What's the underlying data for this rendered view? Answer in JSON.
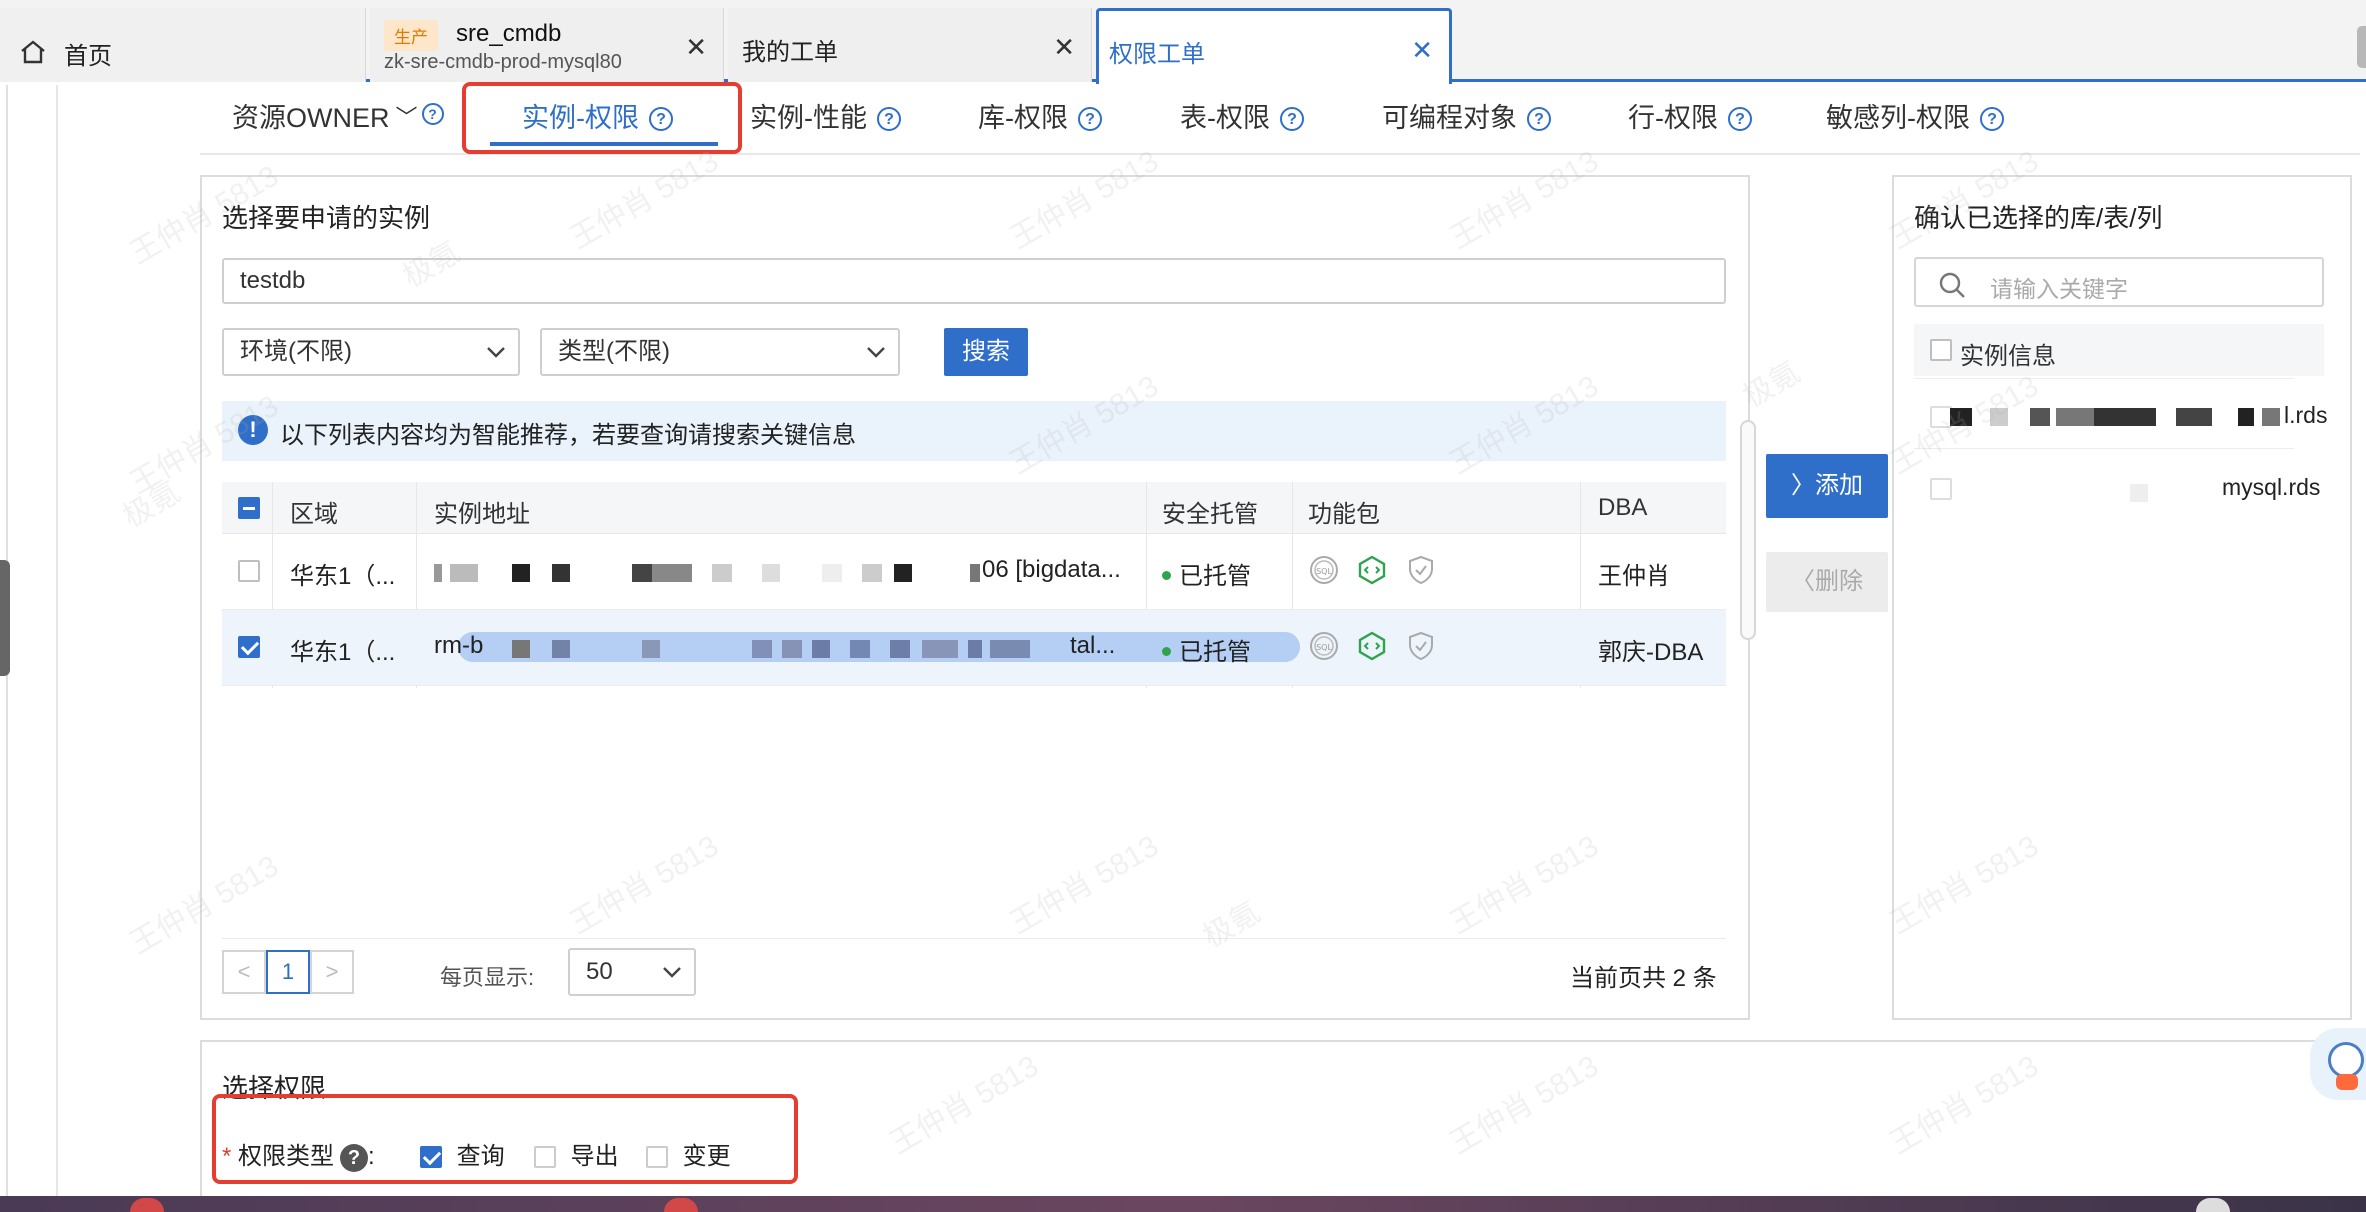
{
  "browser_tabs": {
    "home": {
      "label": "首页"
    },
    "cmdb": {
      "env_badge": "生产",
      "title": "sre_cmdb",
      "subtitle": "zk-sre-cmdb-prod-mysql80"
    },
    "my_tickets": {
      "label": "我的工单"
    },
    "perm_ticket": {
      "label": "权限工单"
    }
  },
  "sub_tabs": [
    {
      "label": "资源OWNER",
      "has_dropdown": true
    },
    {
      "label": "实例-权限",
      "active": true
    },
    {
      "label": "实例-性能"
    },
    {
      "label": "库-权限"
    },
    {
      "label": "表-权限"
    },
    {
      "label": "可编程对象"
    },
    {
      "label": "行-权限"
    },
    {
      "label": "敏感列-权限"
    }
  ],
  "help_glyph": "?",
  "left_panel": {
    "title": "选择要申请的实例",
    "search_value": "testdb",
    "env_select": "环境(不限)",
    "type_select": "类型(不限)",
    "search_button": "搜索",
    "notice": "以下列表内容均为智能推荐，若要查询请搜索关键信息",
    "notice_icon": "!",
    "table": {
      "columns": [
        "区域",
        "实例地址",
        "安全托管",
        "功能包",
        "DBA"
      ],
      "rows": [
        {
          "checked": false,
          "region": "华东1（...",
          "address_suffix": "06 [bigdata...",
          "managed": "已托管",
          "dba": "王仲肖"
        },
        {
          "checked": true,
          "region": "华东1（...",
          "address_prefix": "rm-b",
          "address_suffix": "tal...",
          "managed": "已托管",
          "dba": "郭庆-DBA"
        }
      ]
    },
    "pagination": {
      "prev": "<",
      "current_page": "1",
      "next": ">",
      "page_size_label": "每页显示:",
      "page_size": "50",
      "total_text": "当前页共 2 条"
    }
  },
  "middle_buttons": {
    "add": "添加",
    "remove": "删除"
  },
  "right_panel": {
    "title": "确认已选择的库/表/列",
    "search_placeholder": "请输入关键字",
    "header": "实例信息",
    "items": [
      {
        "text_suffix": "l.rds"
      },
      {
        "text_suffix": "mysql.rds"
      }
    ]
  },
  "permission_section": {
    "title": "选择权限",
    "required_mark": "*",
    "type_label": "权限类型",
    "help_glyph": "?",
    "colon": ":",
    "options": [
      {
        "label": "查询",
        "checked": true
      },
      {
        "label": "导出",
        "checked": false
      },
      {
        "label": "变更",
        "checked": false
      }
    ]
  },
  "watermark": {
    "name": "王仲肖",
    "code": "5813",
    "tag": "极氪"
  },
  "colors": {
    "accent": "#2f6fc9",
    "highlight_box": "#e53d2f",
    "managed_dot": "#2ea44f",
    "env_badge_bg": "#fde6c9",
    "env_badge_text": "#e07b00"
  }
}
